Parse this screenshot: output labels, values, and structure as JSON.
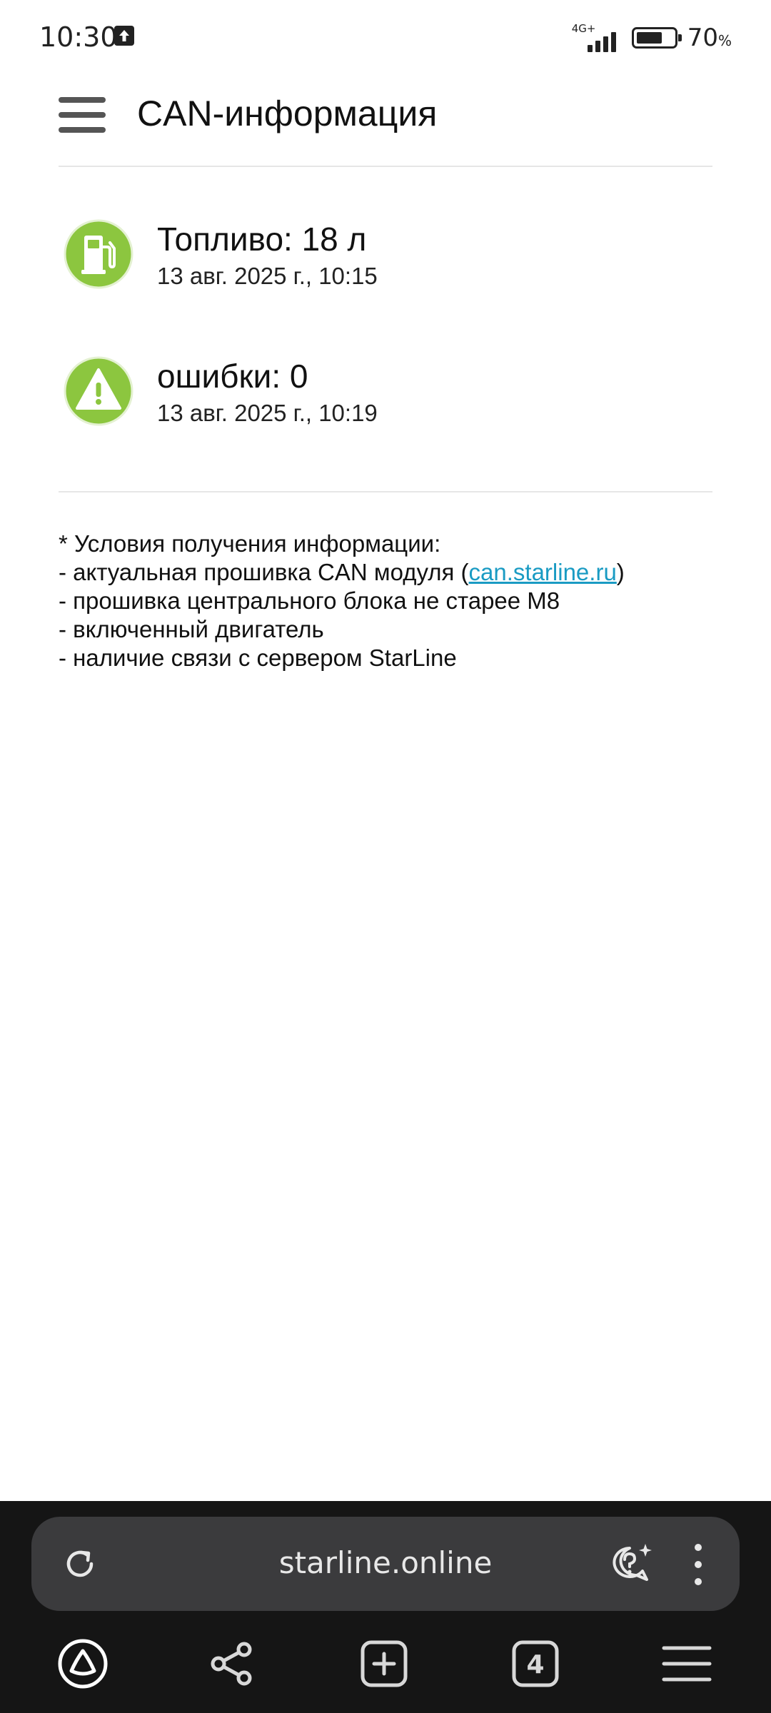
{
  "status_bar": {
    "time": "10:30",
    "network": "4G+",
    "battery_level": 0.7,
    "battery_text": "70",
    "battery_unit": "%"
  },
  "header": {
    "title": "CAN-информация"
  },
  "items": [
    {
      "icon": "fuel-pump-icon",
      "title": "Топливо: 18 л",
      "date": "13 авг. 2025 г., 10:15"
    },
    {
      "icon": "warning-triangle-icon",
      "title": "ошибки: 0",
      "date": "13 авг. 2025 г., 10:19"
    }
  ],
  "notes": {
    "line1": "* Условия получения информации:",
    "line2_prefix": "- актуальная прошивка CAN модуля (",
    "line2_link": "can.starline.ru",
    "line2_suffix": ")",
    "line3": "- прошивка центрального блока не старее М8",
    "line4": "- включенный двигатель",
    "line5": "- наличие связи с сервером StarLine"
  },
  "browser": {
    "url": "starline.online",
    "tab_count": "4"
  },
  "colors": {
    "icon_green": "#8cc63f",
    "link": "#1a9bc3",
    "browser_bg": "#151515",
    "urlbar_bg": "#3b3b3d"
  }
}
